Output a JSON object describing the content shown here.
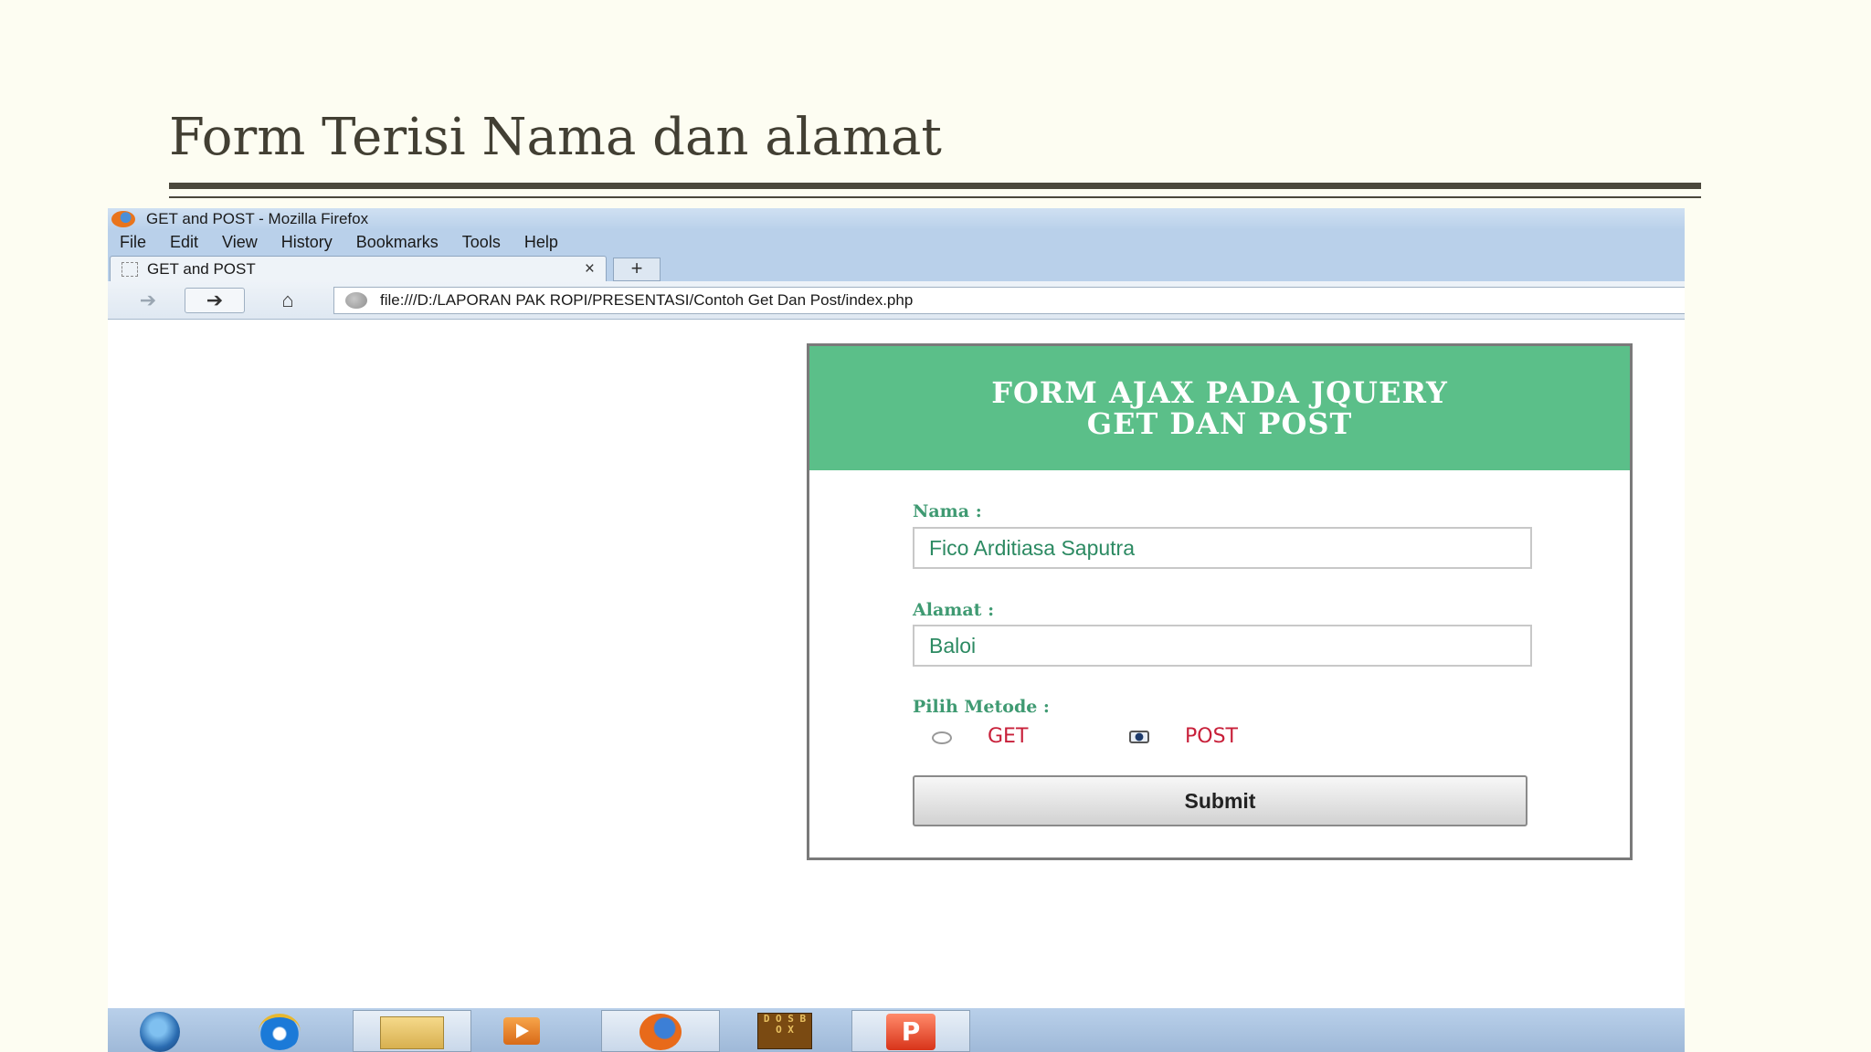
{
  "slide": {
    "title": "Form Terisi Nama dan alamat"
  },
  "browser": {
    "window_title": "GET and POST - Mozilla Firefox",
    "menu": [
      "File",
      "Edit",
      "View",
      "History",
      "Bookmarks",
      "Tools",
      "Help"
    ],
    "tab": {
      "label": "GET and POST",
      "close": "×"
    },
    "new_tab": "+",
    "url": "file:///D:/LAPORAN PAK ROPI/PRESENTASI/Contoh Get Dan Post/index.php"
  },
  "form": {
    "header_line1": "FORM AJAX PADA JQUERY",
    "header_line2": "GET DAN POST",
    "nama_label": "Nama :",
    "nama_value": "Fico Arditiasa Saputra",
    "alamat_label": "Alamat :",
    "alamat_value": "Baloi",
    "metode_label": "Pilih Metode :",
    "option_get": "GET",
    "option_post": "POST",
    "selected_method": "POST",
    "submit_label": "Submit"
  },
  "taskbar": {
    "items": [
      "start-orb-icon",
      "internet-explorer-icon",
      "windows-explorer-icon",
      "media-player-icon",
      "firefox-icon",
      "dosbox-icon",
      "powerpoint-icon"
    ],
    "dosbox_text": "D O S B O X",
    "powerpoint_text": "P"
  },
  "colors": {
    "form_header": "#5bbf89",
    "label_green": "#3f9a72",
    "radio_label_red": "#c8203a",
    "chrome_blue": "#b9d0ea",
    "slide_bg": "#fdfdf2"
  }
}
